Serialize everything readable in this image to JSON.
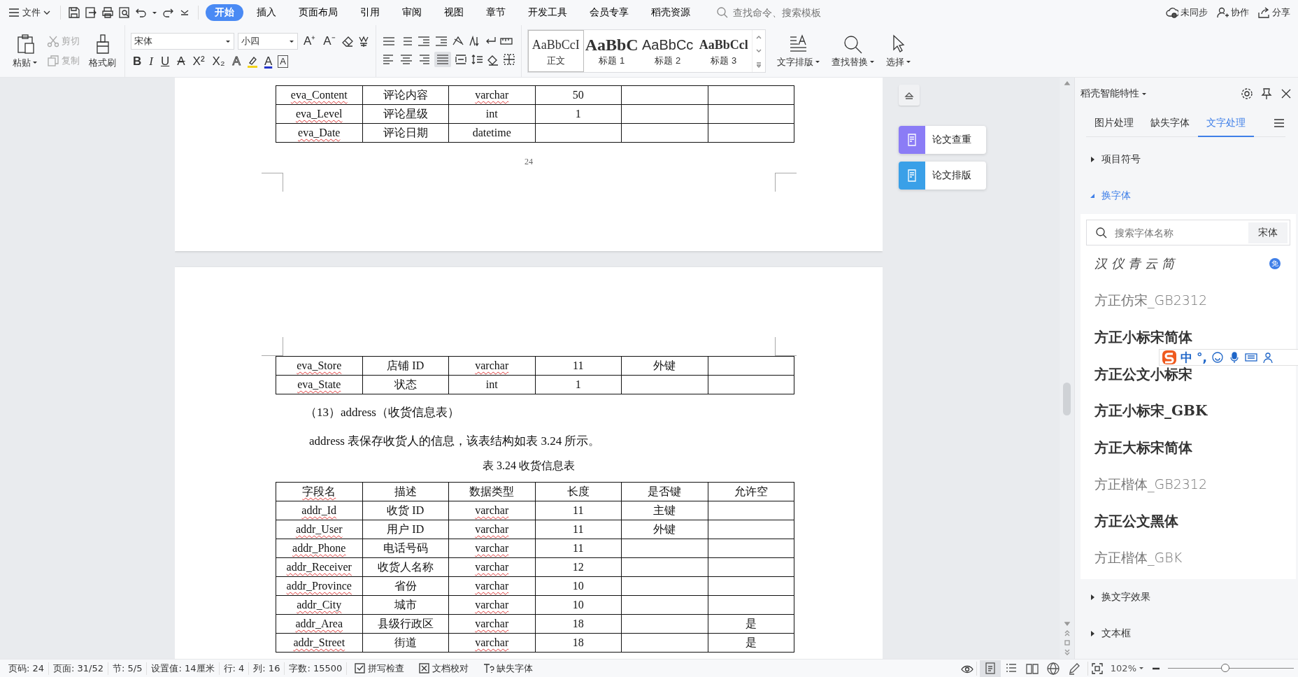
{
  "menu_bar": {
    "file_menu": "文件",
    "tabs": [
      {
        "label": "开始",
        "selected": true
      },
      {
        "label": "插入",
        "selected": false
      },
      {
        "label": "页面布局",
        "selected": false
      },
      {
        "label": "引用",
        "selected": false
      },
      {
        "label": "审阅",
        "selected": false
      },
      {
        "label": "视图",
        "selected": false
      },
      {
        "label": "章节",
        "selected": false
      },
      {
        "label": "开发工具",
        "selected": false
      },
      {
        "label": "会员专享",
        "selected": false
      },
      {
        "label": "稻壳资源",
        "selected": false
      }
    ],
    "search": {
      "placeholder": "查找命令、搜索模板"
    },
    "actions": [
      {
        "label": "未同步",
        "kind": "cloud"
      },
      {
        "label": "协作",
        "kind": "user"
      },
      {
        "label": "分享",
        "kind": "share"
      }
    ]
  },
  "ribbon": {
    "paste": "粘贴",
    "cut": {
      "label": "剪切",
      "disabled": true
    },
    "copy": {
      "label": "复制",
      "disabled": true
    },
    "format_painter": "格式刷",
    "font": {
      "name": "宋体",
      "size": "小四"
    },
    "size_buttons": [
      {
        "glyph": "A⁺"
      },
      {
        "glyph": "A⁻"
      }
    ],
    "format_buttons": [
      {
        "glyph": "B",
        "kind": "bold"
      },
      {
        "glyph": "I",
        "kind": "italic"
      },
      {
        "glyph": "U",
        "kind": "underline"
      },
      {
        "glyph": "A",
        "kind": "strike"
      },
      {
        "glyph": "X²",
        "kind": "plain"
      },
      {
        "glyph": "X₂",
        "kind": "plain"
      },
      {
        "glyph": "A",
        "kind": "outline"
      },
      {
        "kind": "highlight"
      },
      {
        "glyph": "A",
        "kind": "color"
      },
      {
        "glyph": "A",
        "kind": "boxed"
      }
    ],
    "styles": [
      {
        "preview": "AaBbCcI",
        "label": "正文",
        "kind": "normal",
        "selected": true
      },
      {
        "preview": "AaBbC",
        "label": "标题 1",
        "kind": "heading1",
        "selected": false
      },
      {
        "preview": "AaBbCc",
        "label": "标题 2",
        "kind": "heading2",
        "selected": false
      },
      {
        "preview": "AaBbCcl",
        "label": "标题 3",
        "kind": "heading3",
        "selected": false
      }
    ],
    "tools": [
      {
        "label": "文字排版",
        "kind": "layout"
      },
      {
        "label": "查找替换",
        "kind": "find"
      },
      {
        "label": "选择",
        "kind": "select"
      }
    ]
  },
  "document": {
    "pages": [
      {
        "tables": [
          {
            "rows": [
              {
                "field": "eva_Content",
                "description": "评论内容",
                "data_type": "varchar",
                "length": "50"
              },
              {
                "field": "eva_Level",
                "description": "评论星级",
                "data_type": "int",
                "length": "1"
              },
              {
                "field": "eva_Date",
                "description": "评论日期",
                "data_type": "datetime"
              }
            ]
          }
        ],
        "page_number": "24"
      },
      {
        "top_table": {
          "rows": [
            {
              "field": "eva_Store",
              "description": "店铺 ID",
              "data_type": "varchar",
              "length": "11",
              "key": "外键"
            },
            {
              "field": "eva_State",
              "description": "状态",
              "data_type": "int",
              "length": "1"
            }
          ]
        },
        "heading": "（13）address（收货信息表）",
        "paragraph": "address 表保存收货人的信息，该表结构如表 3.24 所示。",
        "caption": "表 3.24 收货信息表",
        "table": {
          "header": {
            "field": "字段名",
            "description": "描述",
            "data_type": "数据类型",
            "length": "长度",
            "key": "是否键",
            "nullable": "允许空"
          },
          "rows": [
            {
              "field": "addr_Id",
              "description": "收货 ID",
              "data_type": "varchar",
              "length": "11",
              "key": "主键"
            },
            {
              "field": "addr_User",
              "description": "用户 ID",
              "data_type": "varchar",
              "length": "11",
              "key": "外键"
            },
            {
              "field": "addr_Phone",
              "description": "电话号码",
              "data_type": "varchar",
              "length": "11"
            },
            {
              "field": "addr_Receiver",
              "description": "收货人名称",
              "data_type": "varchar",
              "length": "12"
            },
            {
              "field": "addr_Province",
              "description": "省份",
              "data_type": "varchar",
              "length": "10"
            },
            {
              "field": "addr_City",
              "description": "城市",
              "data_type": "varchar",
              "length": "10"
            },
            {
              "field": "addr_Area",
              "description": "县级行政区",
              "data_type": "varchar",
              "length": "18",
              "nullable": "是"
            },
            {
              "field": "addr_Street",
              "description": "街道",
              "data_type": "varchar",
              "length": "18",
              "nullable": "是"
            }
          ]
        }
      }
    ]
  },
  "float_buttons": [
    {
      "label": "论文查重",
      "color": "#8b7cf6"
    },
    {
      "label": "论文排版",
      "color": "#3aa0e8"
    }
  ],
  "side_panel": {
    "title": "稻壳智能特性",
    "tabs": [
      {
        "label": "图片处理",
        "selected": false
      },
      {
        "label": "缺失字体",
        "selected": false
      },
      {
        "label": "文字处理",
        "selected": true
      }
    ],
    "sections": [
      {
        "label": "项目符号",
        "expanded": false
      },
      {
        "label": "换字体",
        "expanded": true,
        "font_search": {
          "placeholder": "搜索字体名称",
          "current": "宋体"
        },
        "fonts": [
          {
            "name": "汉仪青云简",
            "kind": "script",
            "badge": "免"
          },
          {
            "name": "方正仿宋_GB2312",
            "kind": "light"
          },
          {
            "name": "方正小标宋简体",
            "kind": "bold"
          },
          {
            "name": "方正公文小标宋",
            "kind": "bold"
          },
          {
            "name": "方正小标宋_GBK",
            "kind": "bold"
          },
          {
            "name": "方正大标宋简体",
            "kind": "bold"
          },
          {
            "name": "方正楷体_GB2312",
            "kind": "light"
          },
          {
            "name": "方正公文黑体",
            "kind": "bold"
          },
          {
            "name": "方正楷体_GBK",
            "kind": "light"
          }
        ]
      },
      {
        "label": "换文字效果",
        "expanded": false
      },
      {
        "label": "文本框",
        "expanded": false
      }
    ]
  },
  "ime_bar": {
    "mode": "中",
    "punctuation": "°,"
  },
  "status_bar": {
    "items": [
      "页码: 24",
      "页面: 31/52",
      "节: 5/5",
      "设置值: 14厘米",
      "行: 4",
      "列: 16",
      "字数: 15500"
    ],
    "tools": [
      {
        "label": "拼写检查",
        "kind": "check"
      },
      {
        "label": "文档校对",
        "kind": "proof"
      },
      {
        "label": "缺失字体",
        "kind": "font"
      }
    ],
    "views": [
      {
        "kind": "page",
        "selected": true
      },
      {
        "kind": "outline",
        "selected": false
      },
      {
        "kind": "read",
        "selected": false
      },
      {
        "kind": "web",
        "selected": false
      },
      {
        "kind": "write",
        "selected": false
      }
    ],
    "zoom": "102%",
    "zoom_slider": {
      "level": 0.46
    }
  }
}
